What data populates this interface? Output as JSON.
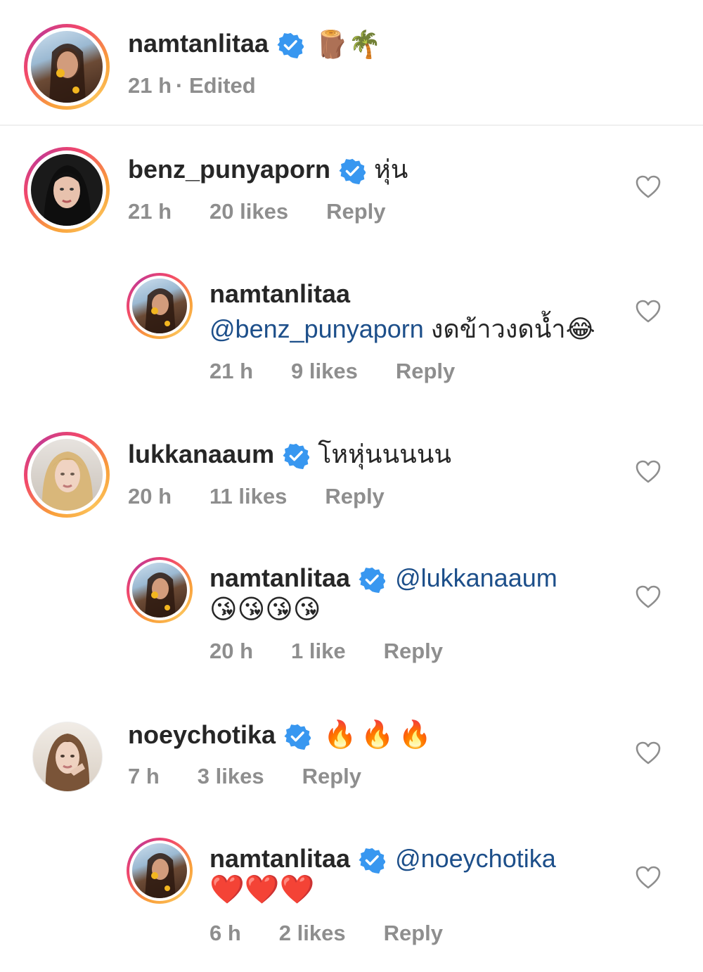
{
  "post": {
    "username": "namtanlitaa",
    "caption_emoji": "🪵🌴",
    "time": "21 h",
    "edited_label": "· Edited"
  },
  "comments": [
    {
      "username": "benz_punyaporn",
      "text": "หุ่น",
      "time": "21 h",
      "likes": "20 likes",
      "reply_label": "Reply",
      "replies": [
        {
          "username": "namtanlitaa",
          "mention": "@benz_punyaporn",
          "text": "งดข้าวงดน้ำ😂",
          "time": "21 h",
          "likes": "9 likes",
          "reply_label": "Reply"
        }
      ]
    },
    {
      "username": "lukkanaaum",
      "text": "โหหุ่นนนนน",
      "time": "20 h",
      "likes": "11 likes",
      "reply_label": "Reply",
      "replies": [
        {
          "username": "namtanlitaa",
          "mention": "@lukkanaaum",
          "text": "😘😘😘😘",
          "time": "20 h",
          "likes": "1 like",
          "reply_label": "Reply"
        }
      ]
    },
    {
      "username": "noeychotika",
      "text": "🔥🔥🔥",
      "time": "7 h",
      "likes": "3 likes",
      "reply_label": "Reply",
      "replies": [
        {
          "username": "namtanlitaa",
          "mention": "@noeychotika",
          "text": "❤️❤️❤️",
          "time": "6 h",
          "likes": "2 likes",
          "reply_label": "Reply"
        }
      ]
    }
  ],
  "colors": {
    "verified": "#3897f0",
    "mention": "#1d4f8a",
    "meta": "#8e8e8e",
    "username": "#262626"
  }
}
